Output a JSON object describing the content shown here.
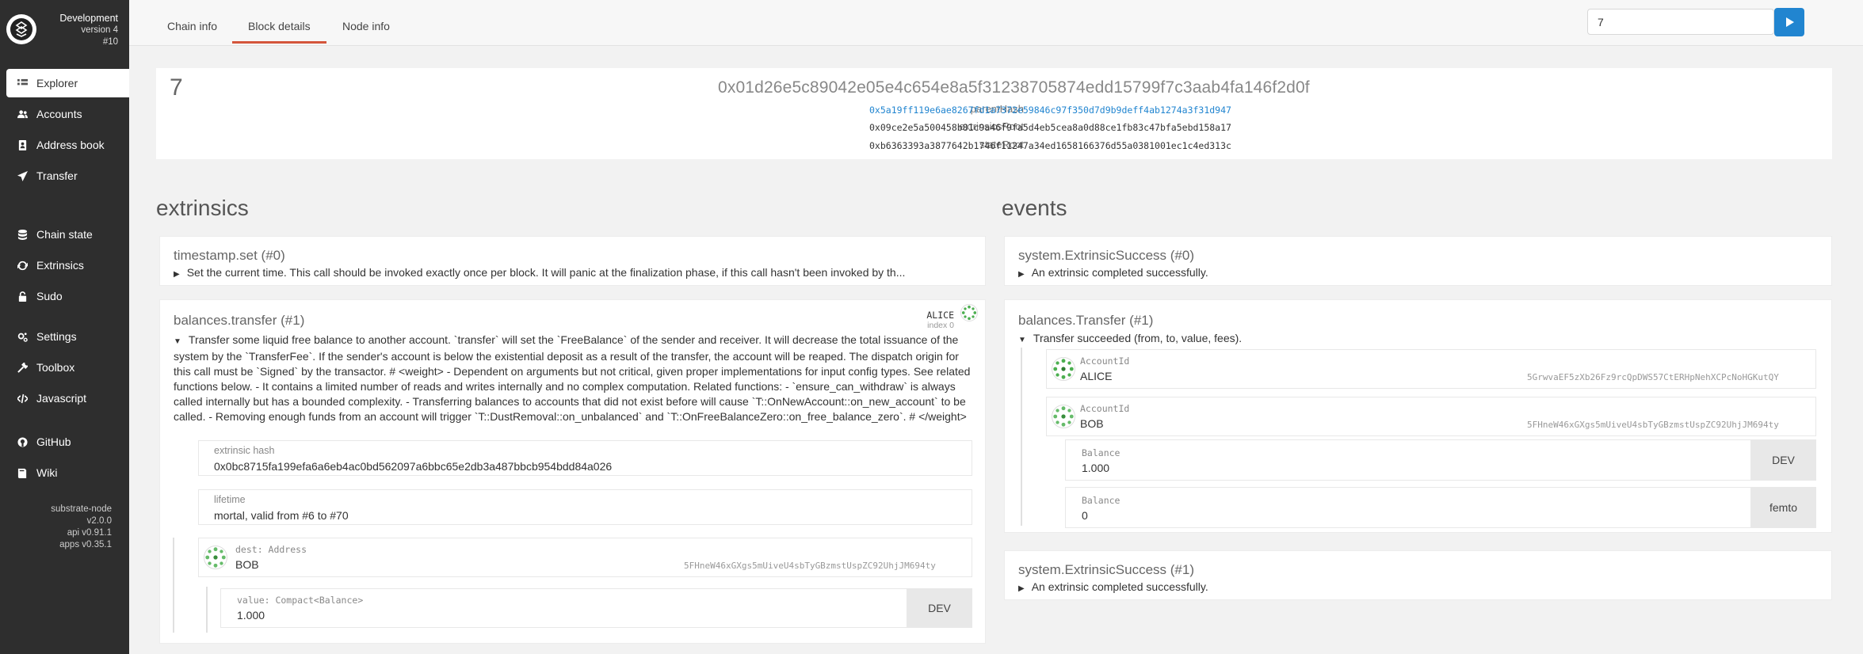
{
  "sidebar": {
    "chain": "Development",
    "version": "version 4",
    "block": "#10",
    "items": [
      {
        "label": "Explorer",
        "icon": "explorer-icon"
      },
      {
        "label": "Accounts",
        "icon": "users-icon"
      },
      {
        "label": "Address book",
        "icon": "address-book-icon"
      },
      {
        "label": "Transfer",
        "icon": "send-icon"
      },
      {
        "label": "Chain state",
        "icon": "database-icon"
      },
      {
        "label": "Extrinsics",
        "icon": "sync-icon"
      },
      {
        "label": "Sudo",
        "icon": "unlock-icon"
      },
      {
        "label": "Settings",
        "icon": "settings-icon"
      },
      {
        "label": "Toolbox",
        "icon": "wrench-icon"
      },
      {
        "label": "Javascript",
        "icon": "code-icon"
      },
      {
        "label": "GitHub",
        "icon": "github-icon"
      },
      {
        "label": "Wiki",
        "icon": "book-icon"
      }
    ],
    "versions": {
      "node": "substrate-node",
      "node_ver": "v2.0.0",
      "api": "api v0.91.1",
      "apps": "apps v0.35.1"
    }
  },
  "tabs": [
    "Chain info",
    "Block details",
    "Node info"
  ],
  "search": {
    "value": "7"
  },
  "header": {
    "number": "7",
    "hash": "0x01d26e5c89042e05e4c654e8a5f31238705874edd15799f7c3aab4fa146f2d0f",
    "parent_label": "parentHash",
    "parent_value": "0x5a19ff119e6ae8267fd1a7372e59846c97f350d7d9b9deff4ab1274a3f31d947",
    "ext_label": "extrinsicsRoot",
    "ext_value": "0x09ce2e5a500458b81c9a46f9fa5d4eb5cea8a0d88ce1fb83c47bfa5ebd158a17",
    "state_label": "stateRoot",
    "state_value": "0xb6363393a3877642b1746f11247a34ed1658166376d55a0381001ec1c4ed313c"
  },
  "extrinsics": {
    "title": "extrinsics",
    "items": [
      {
        "title": "timestamp.set (#0)",
        "desc": "Set the current time. This call should be invoked exactly once per block. It will panic at the finalization phase, if this call hasn't been invoked by th..."
      },
      {
        "title": "balances.transfer (#1)",
        "signer": "ALICE",
        "signer_index": "index 0",
        "desc": "Transfer some liquid free balance to another account. `transfer` will set the `FreeBalance` of the sender and receiver. It will decrease the total issuance of the system by the `TransferFee`. If the sender's account is below the existential deposit as a result of the transfer, the account will be reaped. The dispatch origin for this call must be `Signed` by the transactor. # <weight> - Dependent on arguments but not critical, given proper implementations for input config types. See related functions below. - It contains a limited number of reads and writes internally and no complex computation. Related functions: - `ensure_can_withdraw` is always called internally but has a bounded complexity. - Transferring balances to accounts that did not exist before will cause `T::OnNewAccount::on_new_account` to be called. - Removing enough funds from an account will trigger `T::DustRemoval::on_unbalanced` and `T::OnFreeBalanceZero::on_free_balance_zero`. # </weight>",
        "hash_label": "extrinsic hash",
        "hash_value": "0x0bc8715fa199efa6a6eb4ac0bd562097a6bbc65e2db3a487bbcb954bdd84a026",
        "lifetime_label": "lifetime",
        "lifetime_value": "mortal, valid from #6 to #70",
        "dest_label": "dest: Address",
        "dest_name": "BOB",
        "dest_addr": "5FHneW46xGXgs5mUiveU4sbTyGBzmstUspZC92UhjJM694ty",
        "value_label": "value: Compact<Balance>",
        "value_value": "1.000",
        "value_unit": "DEV"
      }
    ]
  },
  "events": {
    "title": "events",
    "items": [
      {
        "title": "system.ExtrinsicSuccess (#0)",
        "desc": "An extrinsic completed successfully."
      },
      {
        "title": "balances.Transfer (#1)",
        "desc": "Transfer succeeded (from, to, value, fees).",
        "from_label": "AccountId",
        "from_name": "ALICE",
        "from_addr": "5GrwvaEF5zXb26Fz9rcQpDWS57CtERHpNehXCPcNoHGKutQY",
        "to_label": "AccountId",
        "to_name": "BOB",
        "to_addr": "5FHneW46xGXgs5mUiveU4sbTyGBzmstUspZC92UhjJM694ty",
        "value_label": "Balance",
        "value_value": "1.000",
        "value_unit": "DEV",
        "fee_label": "Balance",
        "fee_value": "0",
        "fee_unit": "femto"
      },
      {
        "title": "system.ExtrinsicSuccess (#1)",
        "desc": "An extrinsic completed successfully."
      }
    ]
  },
  "colors": {
    "accent": "#2185d0",
    "tab_underline": "#d4553b",
    "sidebar": "#2e2e2e"
  }
}
